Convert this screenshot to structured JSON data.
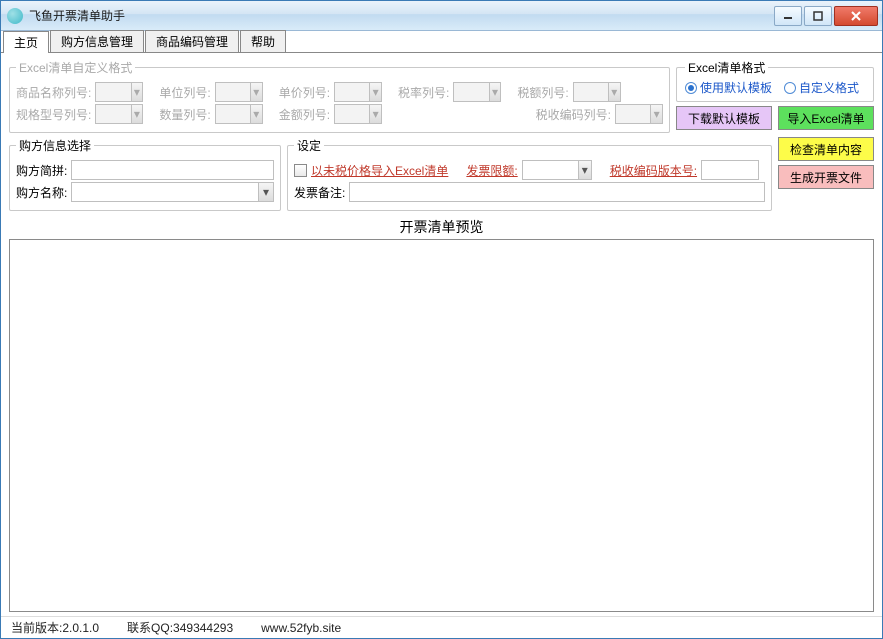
{
  "window": {
    "title": "飞鱼开票清单助手"
  },
  "tabs": [
    "主页",
    "购方信息管理",
    "商品编码管理",
    "帮助"
  ],
  "excelCustom": {
    "legend": "Excel清单自定义格式",
    "labels": {
      "productNameCol": "商品名称列号:",
      "unitCol": "单位列号:",
      "priceCol": "单价列号:",
      "taxRateCol": "税率列号:",
      "taxAmountCol": "税额列号:",
      "specCol": "规格型号列号:",
      "qtyCol": "数量列号:",
      "amountCol": "金额列号:",
      "taxCodeCol": "税收编码列号:"
    }
  },
  "excelFmt": {
    "legend": "Excel清单格式",
    "opt1": "使用默认模板",
    "opt2": "自定义格式"
  },
  "btns": {
    "downloadTpl": "下载默认模板",
    "importExcel": "导入Excel清单",
    "check": "检查清单内容",
    "generate": "生成开票文件"
  },
  "buyer": {
    "legend": "购方信息选择",
    "pinyinLabel": "购方简拼:",
    "nameLabel": "购方名称:"
  },
  "settings": {
    "legend": "设定",
    "noTaxImport": "以未税价格导入Excel清单",
    "invoiceLimit": "发票限额:",
    "taxCodeVer": "税收编码版本号:",
    "remarkLabel": "发票备注:"
  },
  "preview": {
    "title": "开票清单预览"
  },
  "status": {
    "version": "当前版本:2.0.1.0",
    "qq": "联系QQ:349344293",
    "site": "www.52fyb.site"
  }
}
